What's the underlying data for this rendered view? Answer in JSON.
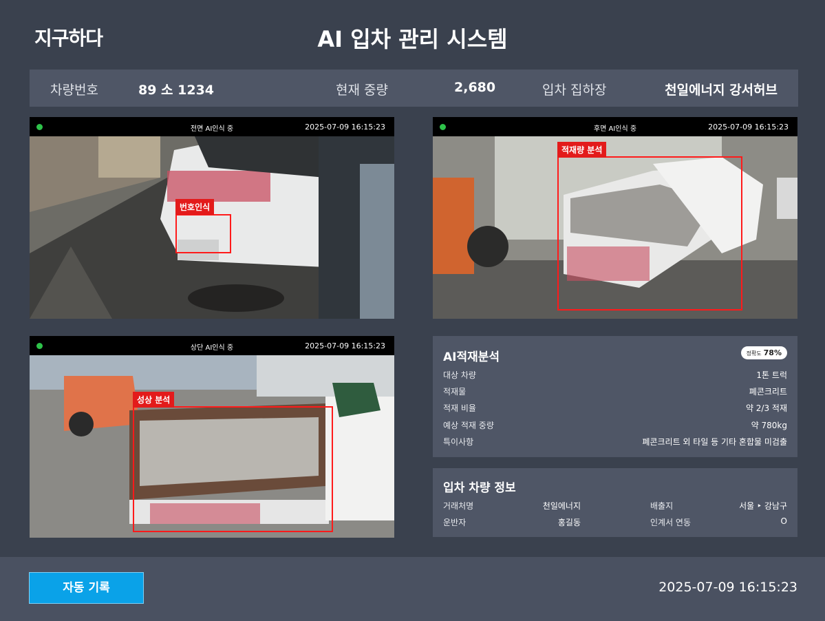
{
  "header": {
    "logo": "지구하다",
    "title": "AI 입차 관리 시스템"
  },
  "info": {
    "vehicle_label": "차량번호",
    "vehicle_value": "89 소 1234",
    "weight_label": "현재 중량",
    "weight_value": "2,680",
    "site_label": "입차 집하장",
    "site_value": "천일에너지 강서허브"
  },
  "cameras": [
    {
      "label": "전면 AI인식 중",
      "time": "2025-07-09 16:15:23",
      "tag": "번호인식"
    },
    {
      "label": "후면 AI인식 중",
      "time": "2025-07-09 16:15:23",
      "tag": "적재량 분석"
    },
    {
      "label": "상단 AI인식 중",
      "time": "2025-07-09 16:15:23",
      "tag": "성상 분석"
    }
  ],
  "analysis": {
    "title": "AI적재분석",
    "accuracy_label": "정확도",
    "accuracy_value": "78%",
    "rows": [
      {
        "key": "대상 차량",
        "value": "1톤 트럭"
      },
      {
        "key": "적재물",
        "value": "폐콘크리트"
      },
      {
        "key": "적재 비율",
        "value": "약 2/3 적재"
      },
      {
        "key": "예상 적재 중량",
        "value": "약 780kg"
      },
      {
        "key": "특이사항",
        "value": "폐콘크리트 외 타일 등 기타 혼합물 미검출"
      }
    ]
  },
  "vehicle_info": {
    "title": "입차 차량 정보",
    "client_label": "거래처명",
    "client_value": "천일에너지",
    "origin_label": "배출지",
    "origin_value": "서울 ‣ 강남구",
    "driver_label": "운반자",
    "driver_value": "홍길동",
    "handover_label": "인계서 연동",
    "handover_value": "O"
  },
  "footer": {
    "button_label": "자동 기록",
    "time": "2025-07-09 16:15:23"
  },
  "colors": {
    "background": "#3a414e",
    "panel": "#4f5666",
    "accent": "#0aa2e8",
    "detect": "#e31b1b",
    "live": "#2ec24a"
  }
}
